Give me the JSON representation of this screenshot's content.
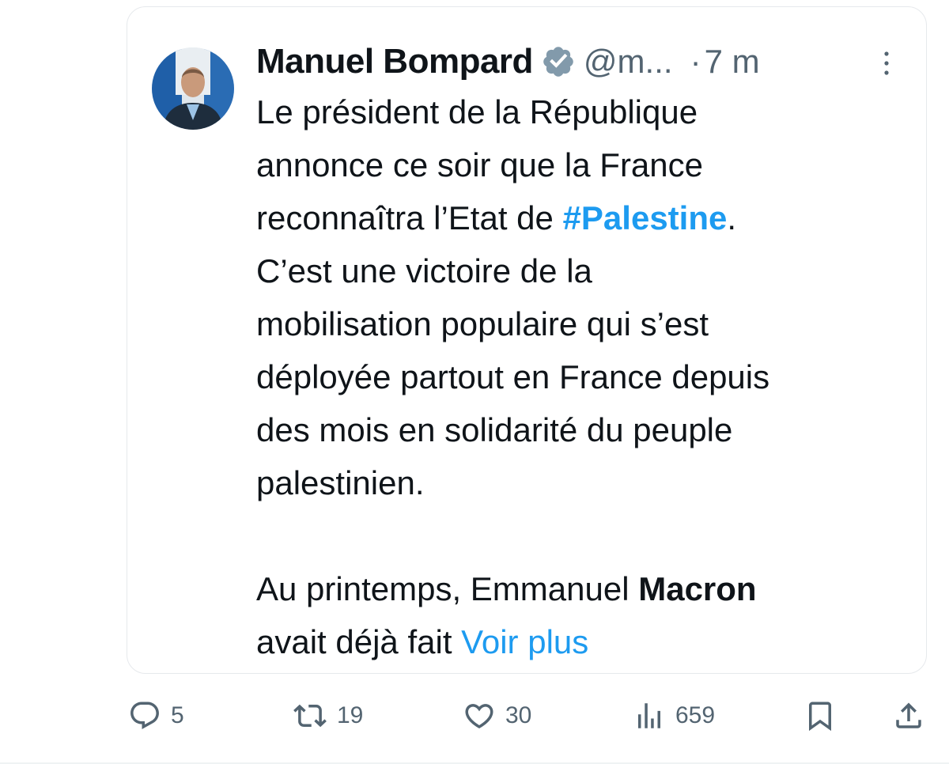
{
  "tweet": {
    "author_name": "Manuel Bompard",
    "handle": "@m...",
    "separator": "·",
    "time": "7 m",
    "avatar_icon": "avatar-photo-icon",
    "verified_icon": "verified-badge-icon",
    "body_lines": [
      "Le président de la République",
      "annonce ce soir que la France",
      "reconnaîtra l’Etat de ",
      "C’est une victoire de la",
      "mobilisation populaire qui s’est",
      "déployée partout en France depuis",
      "des mois en solidarité du peuple",
      "palestinien."
    ],
    "hashtag": "#Palestine",
    "hashtag_suffix": ".",
    "para2_line1_prefix": "Au printemps, Emmanuel ",
    "para2_bold": "Macron",
    "para2_line2": "avait déjà fait ",
    "see_more": "Voir plus"
  },
  "actions": {
    "reply": {
      "icon": "reply-icon",
      "count": "5"
    },
    "retweet": {
      "icon": "retweet-icon",
      "count": "19"
    },
    "like": {
      "icon": "heart-icon",
      "count": "30"
    },
    "views": {
      "icon": "views-icon",
      "count": "659"
    },
    "bookmark": {
      "icon": "bookmark-icon"
    },
    "share": {
      "icon": "share-icon"
    }
  },
  "colors": {
    "text": "#0f1419",
    "secondary": "#536471",
    "link": "#1d9bf0",
    "border": "#e6e9ec",
    "verified": "#829aab"
  }
}
